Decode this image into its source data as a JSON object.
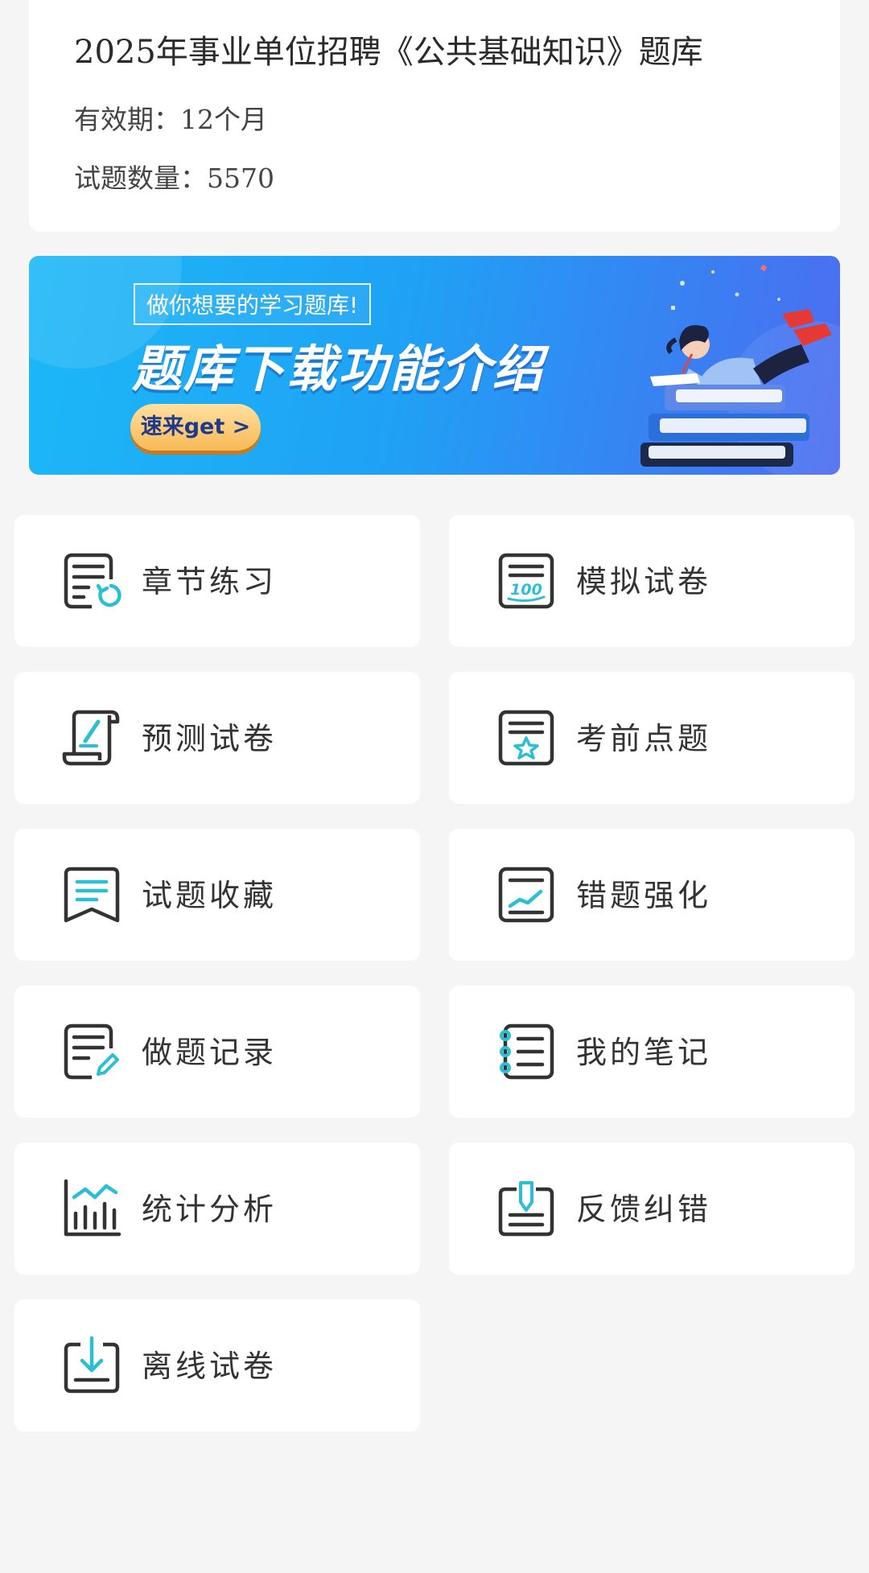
{
  "info": {
    "title": "2025年事业单位招聘《公共基础知识》题库",
    "validity": "有效期：12个月",
    "count": "试题数量：5570"
  },
  "banner": {
    "tag": "做你想要的学习题库!",
    "headline": "题库下载功能介绍",
    "cta": "速来get >"
  },
  "colors": {
    "accent": "#2bbfd6",
    "icon_stroke": "#333333",
    "background": "#f5f5f5",
    "card": "#ffffff"
  },
  "menu": [
    {
      "label": "章节练习",
      "icon": "chapter-practice-icon"
    },
    {
      "label": "模拟试卷",
      "icon": "mock-exam-icon"
    },
    {
      "label": "预测试卷",
      "icon": "prediction-exam-icon"
    },
    {
      "label": "考前点题",
      "icon": "key-points-icon"
    },
    {
      "label": "试题收藏",
      "icon": "favorites-icon"
    },
    {
      "label": "错题强化",
      "icon": "mistakes-icon"
    },
    {
      "label": "做题记录",
      "icon": "records-icon"
    },
    {
      "label": "我的笔记",
      "icon": "notes-icon"
    },
    {
      "label": "统计分析",
      "icon": "statistics-icon"
    },
    {
      "label": "反馈纠错",
      "icon": "feedback-icon"
    },
    {
      "label": "离线试卷",
      "icon": "offline-download-icon"
    }
  ]
}
